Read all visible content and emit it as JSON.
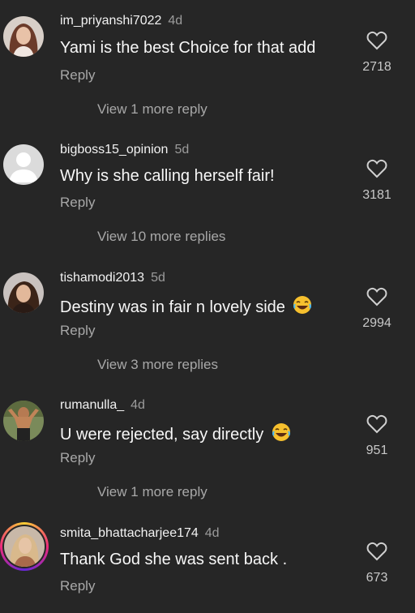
{
  "comments": [
    {
      "username": "im_priyanshi7022",
      "time": "4d",
      "text": "Yami is the best Choice for that add",
      "reply": "Reply",
      "likes": "2718",
      "view_more": "View 1 more reply",
      "emoji": ""
    },
    {
      "username": "bigboss15_opinion",
      "time": "5d",
      "text": "Why is she calling herself fair!",
      "reply": "Reply",
      "likes": "3181",
      "view_more": "View 10 more replies",
      "emoji": ""
    },
    {
      "username": "tishamodi2013",
      "time": "5d",
      "text": "Destiny was in fair n lovely side",
      "reply": "Reply",
      "likes": "2994",
      "view_more": "View 3 more replies",
      "emoji": "laughing-emoji"
    },
    {
      "username": "rumanulla_",
      "time": "4d",
      "text": "U were rejected, say directly",
      "reply": "Reply",
      "likes": "951",
      "view_more": "View 1 more reply",
      "emoji": "laughing-emoji"
    },
    {
      "username": "smita_bhattacharjee174",
      "time": "4d",
      "text": "Thank God she was sent back .",
      "reply": "Reply",
      "likes": "673",
      "view_more": "",
      "emoji": ""
    }
  ],
  "colors": {
    "background": "#262626",
    "secondary_text": "#a8a8a8",
    "primary_text": "#f5f5f5"
  }
}
